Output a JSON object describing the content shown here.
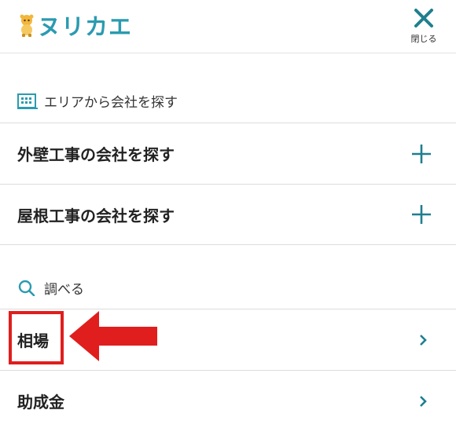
{
  "header": {
    "logo_text": "ヌリカエ",
    "close_label": "閉じる"
  },
  "area_section": {
    "heading": "エリアから会社を探す",
    "icon": "building-icon",
    "items": [
      {
        "label": "外壁工事の会社を探す",
        "icon": "plus-icon"
      },
      {
        "label": "屋根工事の会社を探す",
        "icon": "plus-icon"
      }
    ]
  },
  "research_section": {
    "heading": "調べる",
    "icon": "search-icon",
    "items": [
      {
        "label": "相場",
        "icon": "chevron-right-icon"
      },
      {
        "label": "助成金",
        "icon": "chevron-right-icon"
      }
    ]
  },
  "colors": {
    "accent": "#2a9bb0",
    "teal_icon": "#1f7f8f",
    "annotation_red": "#e01e1e",
    "divider": "#dcdcdc"
  }
}
